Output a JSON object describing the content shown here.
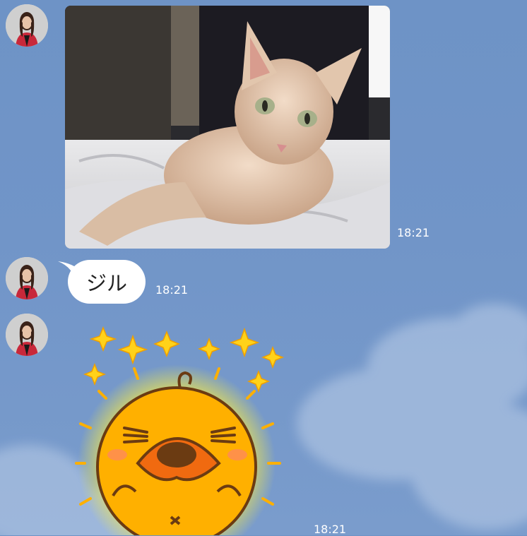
{
  "messages": [
    {
      "type": "image",
      "time": "18:21"
    },
    {
      "type": "text",
      "text": "ジル",
      "time": "18:21"
    },
    {
      "type": "sticker",
      "time": "18:21"
    }
  ],
  "icons": [
    "avatar",
    "cat-photo",
    "duck-sticker"
  ],
  "colors": {
    "background": "#7195c8",
    "bubble": "#ffffff",
    "timestamp": "#ffffff",
    "sticker_glow": "#ffe800",
    "duck_body": "#ffb000",
    "beak": "#f06a10"
  }
}
